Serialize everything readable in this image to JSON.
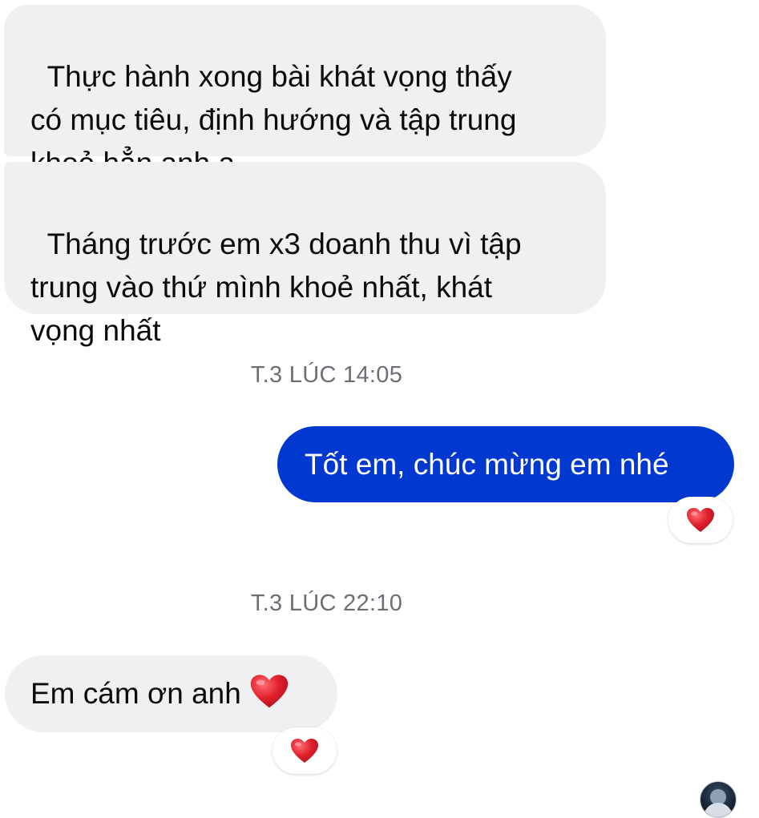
{
  "conversation": {
    "messages": [
      {
        "direction": "incoming",
        "text": "Thực hành xong bài khát vọng thấy\ncó mục tiêu, định hướng và tập trung\nkhoẻ hẳn anh ạ"
      },
      {
        "direction": "incoming",
        "text": "Tháng trước em x3 doanh thu vì tập\ntrung vào thứ mình khoẻ nhất, khát\nvọng nhất"
      },
      {
        "direction": "outgoing",
        "text": "Tốt em, chúc mừng em nhé",
        "reaction": "heart-icon"
      },
      {
        "direction": "incoming",
        "text": "Em cám ơn anh",
        "inline_icon": "heart-icon",
        "reaction": "heart-icon"
      }
    ],
    "timestamps": [
      "T.3 LÚC 14:05",
      "T.3 LÚC 22:10"
    ]
  },
  "colors": {
    "incoming_bubble": "#f0f0f2",
    "outgoing_bubble": "#0038d0",
    "timestamp_text": "#6b6f76",
    "heart": "#e0202c"
  }
}
